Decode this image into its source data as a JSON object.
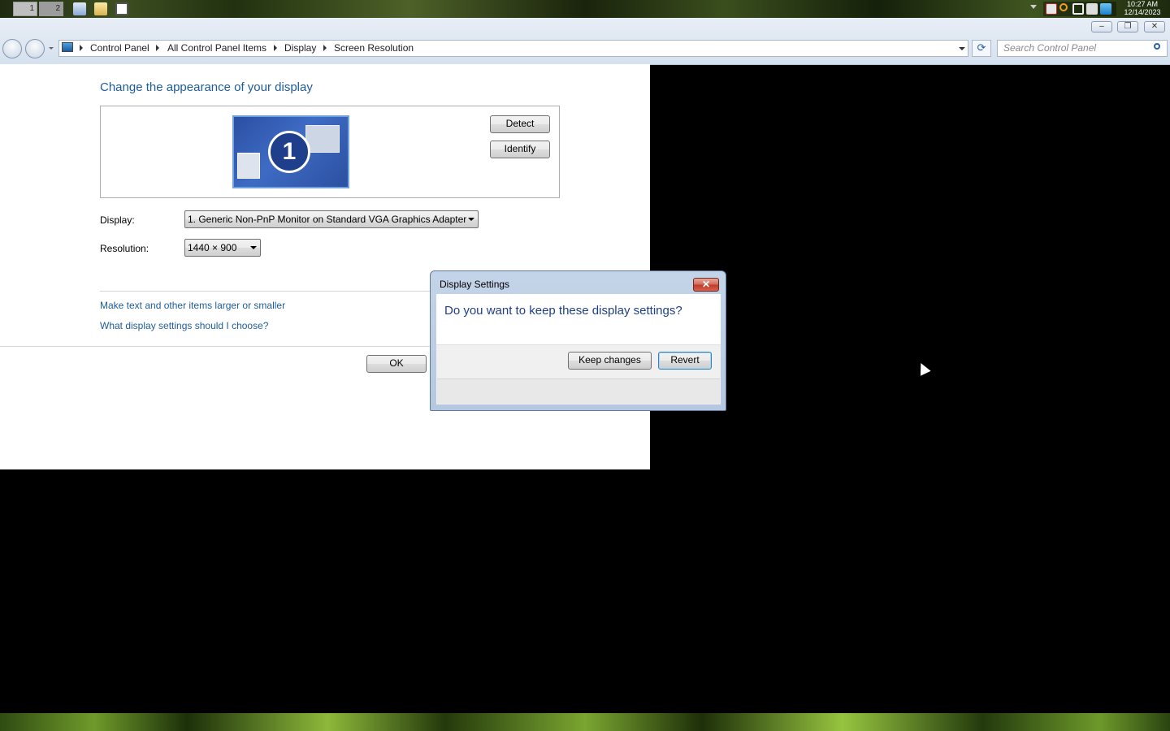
{
  "taskbar": {
    "desktops": [
      {
        "label": "1"
      },
      {
        "label": "2"
      }
    ],
    "quick_launch": [
      "show-desktop-icon",
      "folder-icon",
      "window-icon"
    ],
    "tray_icons": [
      "action-center-icon",
      "search-icon",
      "network-icon",
      "volume-muted-icon",
      "shield-icon"
    ],
    "clock": {
      "time": "10:27 AM",
      "date": "12/14/2023"
    }
  },
  "window": {
    "controls": {
      "minimize": "–",
      "restore": "❐",
      "close": "✕"
    }
  },
  "address_bar": {
    "breadcrumb": [
      "Control Panel",
      "All Control Panel Items",
      "Display",
      "Screen Resolution"
    ],
    "search_placeholder": "Search Control Panel"
  },
  "main": {
    "heading": "Change the appearance of your display",
    "monitor_number": "1",
    "detect_label": "Detect",
    "identify_label": "Identify",
    "display_label": "Display:",
    "display_value": "1. Generic Non-PnP Monitor on Standard VGA Graphics Adapter",
    "resolution_label": "Resolution:",
    "resolution_value": "1440 × 900",
    "link_text_size": "Make text and other items larger or smaller",
    "link_help": "What display settings should I choose?",
    "ok_label": "OK"
  },
  "dialog": {
    "title": "Display Settings",
    "close_label": "✕",
    "question": "Do you want to keep these display settings?",
    "keep_label": "Keep changes",
    "revert_label": "Revert"
  }
}
